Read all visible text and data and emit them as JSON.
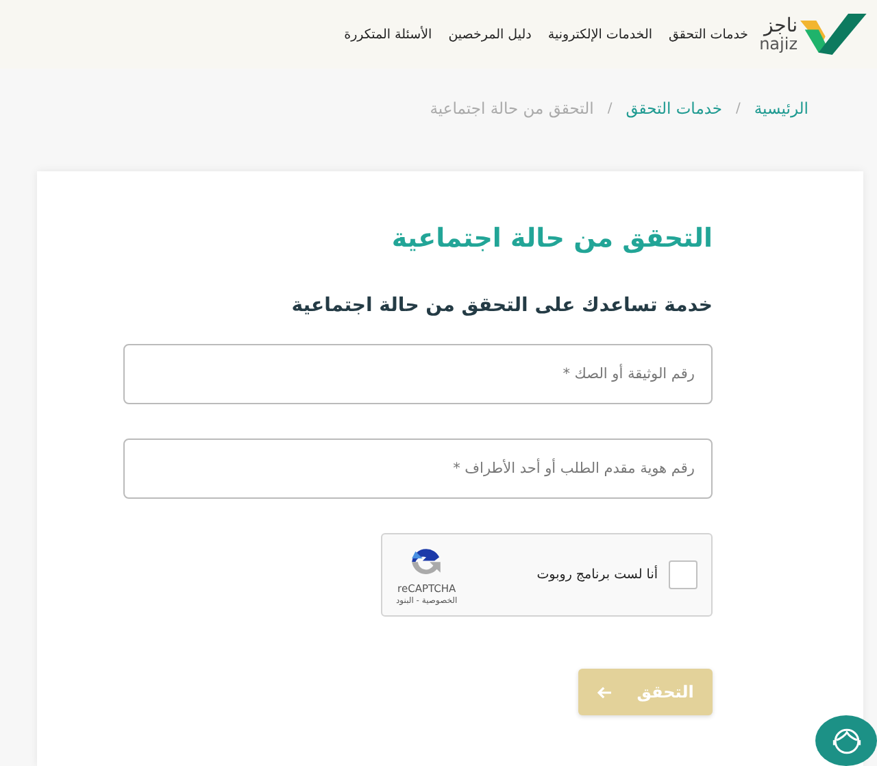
{
  "header": {
    "logo": {
      "arabic": "ناجز",
      "latin": "najiz"
    },
    "nav": [
      {
        "label": "خدمات التحقق"
      },
      {
        "label": "الخدمات الإلكترونية"
      },
      {
        "label": "دليل المرخصين"
      },
      {
        "label": "الأسئلة المتكررة"
      }
    ]
  },
  "breadcrumb": [
    {
      "kind": "link",
      "label": "الرئيسية",
      "current": false
    },
    {
      "kind": "separator",
      "label": "/"
    },
    {
      "kind": "link",
      "label": "خدمات التحقق",
      "current": false
    },
    {
      "kind": "separator",
      "label": "/"
    },
    {
      "kind": "link",
      "label": "التحقق من حالة اجتماعية",
      "current": true
    }
  ],
  "card": {
    "title": "التحقق من حالة اجتماعية",
    "subtitle": "خدمة تساعدك على التحقق من حالة اجتماعية",
    "fields": [
      {
        "placeholder": "رقم الوثيقة أو الصك *"
      },
      {
        "placeholder": "رقم هوية مقدم الطلب أو أحد الأطراف *"
      }
    ],
    "captcha": {
      "label": "أنا لست برنامج روبوت",
      "checked": false,
      "brand": "reCAPTCHA",
      "links": "الخصوصية - البنود"
    },
    "submit": {
      "label": "التحقق",
      "disabled": true
    }
  }
}
